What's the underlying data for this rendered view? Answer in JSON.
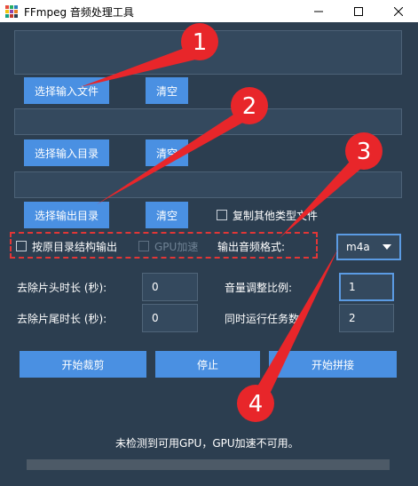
{
  "window": {
    "title": "FFmpeg 音频处理工具"
  },
  "buttons": {
    "select_input_files": "选择输入文件",
    "clear_1": "清空",
    "select_input_dir": "选择输入目录",
    "clear_2": "清空",
    "select_output_dir": "选择输出目录",
    "clear_3": "清空",
    "start_trim": "开始裁剪",
    "stop": "停止",
    "start_concat": "开始拼接"
  },
  "checkboxes": {
    "copy_other_types": "复制其他类型文件",
    "keep_dir_structure": "按原目录结构输出",
    "gpu_accel": "GPU加速"
  },
  "format": {
    "label": "输出音频格式:",
    "value": "m4a"
  },
  "fields": {
    "trim_head_label": "去除片头时长 (秒):",
    "trim_head_value": "0",
    "trim_tail_label": "去除片尾时长 (秒):",
    "trim_tail_value": "0",
    "volume_label": "音量调整比例:",
    "volume_value": "1",
    "concurrency_label": "同时运行任务数",
    "concurrency_value": "2"
  },
  "status": {
    "message": "未检测到可用GPU，GPU加速不可用。"
  },
  "progress": {
    "fraction": 0
  },
  "annotations": {
    "n1": "1",
    "n2": "2",
    "n3": "3",
    "n4": "4",
    "color": "#e8262a"
  },
  "colors": {
    "background": "#2c3e50",
    "button": "#4a90e2",
    "accent_border": "#5b9be3",
    "dashed_highlight": "#e23636"
  }
}
